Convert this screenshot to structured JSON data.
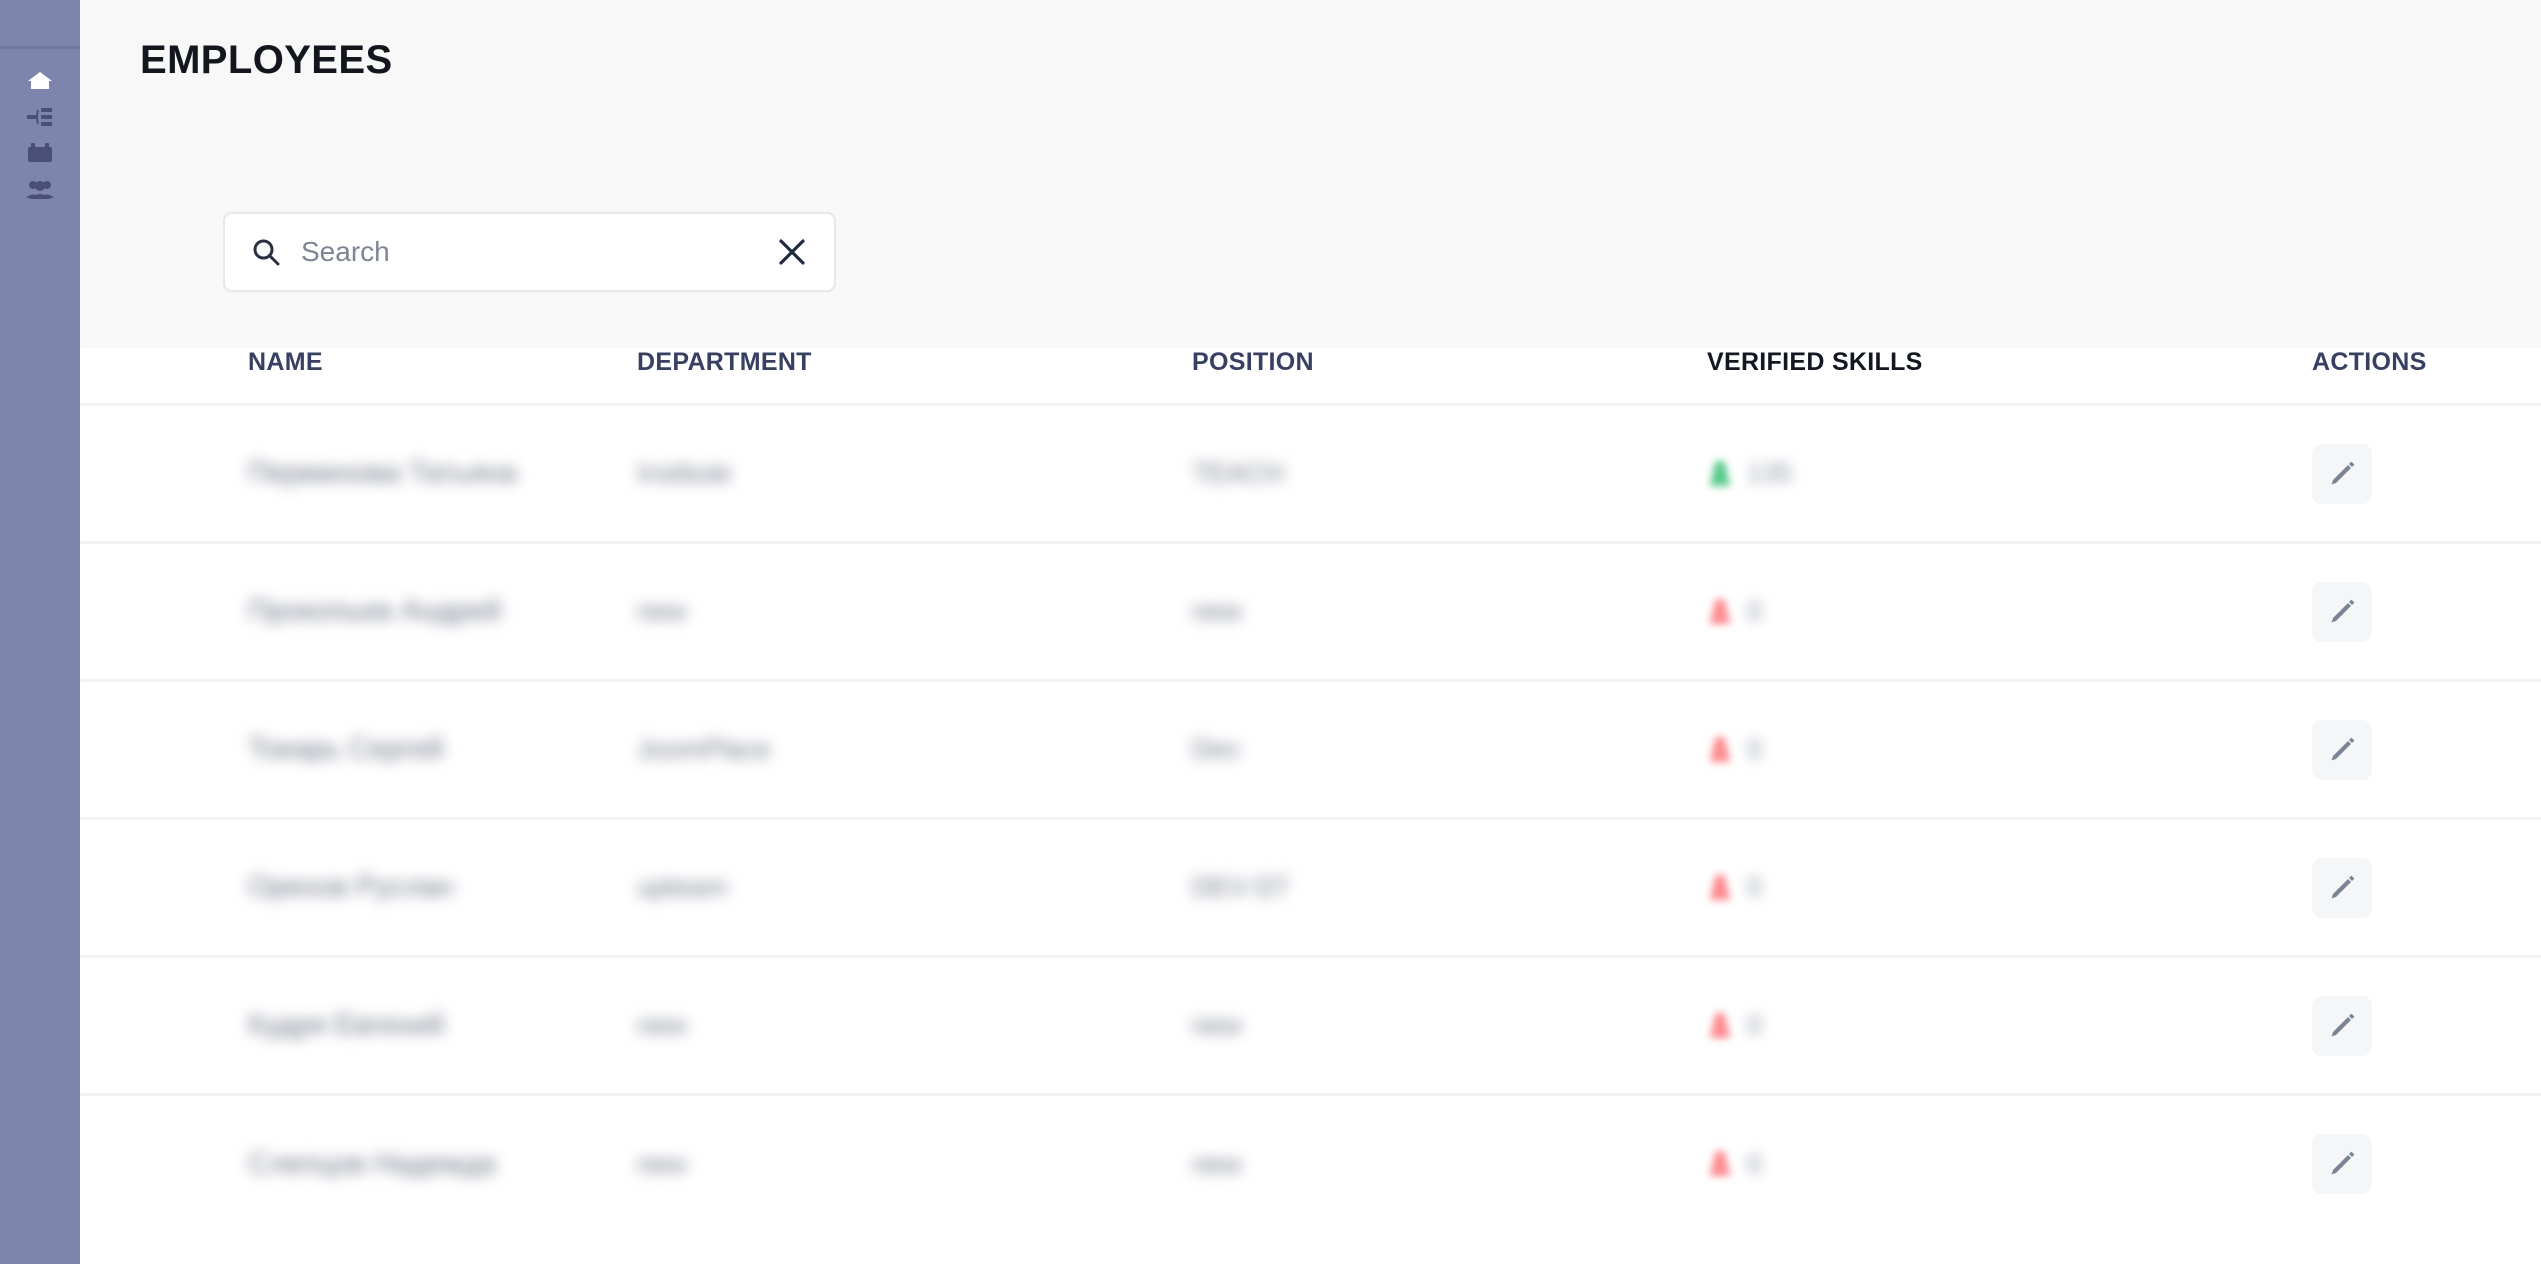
{
  "sidebar": {
    "background_color": "#7d85ad",
    "items": [
      {
        "icon": "home-icon",
        "name": "sidebar-item-home",
        "active": true
      },
      {
        "icon": "list-filter-icon",
        "name": "sidebar-item-list",
        "active": false
      },
      {
        "icon": "calendar-icon",
        "name": "sidebar-item-calendar",
        "active": false
      },
      {
        "icon": "people-group-icon",
        "name": "sidebar-item-employees",
        "active": false
      }
    ]
  },
  "header": {
    "title": "EMPLOYEES"
  },
  "search": {
    "value": "",
    "placeholder": "Search",
    "search_icon": "search-icon",
    "clear_icon": "close-icon"
  },
  "table": {
    "columns": [
      "NAME",
      "DEPARTMENT",
      "POSITION",
      "VERIFIED SKILLS",
      "ACTIONS"
    ],
    "action_icon": "pencil-edit-icon",
    "badge_colors": {
      "verified": "#58c98a",
      "unverified": "#fd8a8f"
    },
    "rows": [
      {
        "name": "Перминова Татьяна",
        "department": "Institute",
        "position": "TEACH",
        "skills_status": "verified",
        "skills_count": "135",
        "action": "edit"
      },
      {
        "name": "Прокопьев Андрей",
        "department": "new",
        "position": "new",
        "skills_status": "unverified",
        "skills_count": "0",
        "action": "edit"
      },
      {
        "name": "Токарь Сергей",
        "department": "JoomPlace",
        "position": "Dev",
        "skills_status": "unverified",
        "skills_count": "0",
        "action": "edit"
      },
      {
        "name": "Орехов Руслан",
        "department": "upteam",
        "position": "DEV-ST",
        "skills_status": "unverified",
        "skills_count": "0",
        "action": "edit"
      },
      {
        "name": "Кудря Евгений",
        "department": "new",
        "position": "new",
        "skills_status": "unverified",
        "skills_count": "0",
        "action": "edit"
      },
      {
        "name": "Слепцов Надежда",
        "department": "new",
        "position": "new",
        "skills_status": "unverified",
        "skills_count": "0",
        "action": "edit"
      }
    ]
  }
}
